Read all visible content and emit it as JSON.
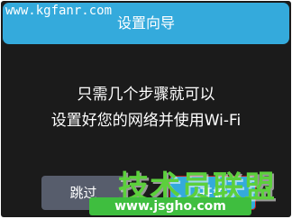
{
  "header": {
    "title": "设置向导"
  },
  "watermark_top": "www.kgfanr.com",
  "message": {
    "line1": "只需几个步骤就可以",
    "line2": "设置好您的网络并使用Wi-Fi"
  },
  "buttons": {
    "skip": "跳过",
    "start": "开始"
  },
  "watermark_bottom": {
    "logo": "技术员联盟",
    "url": "www.jsgho.com"
  },
  "colors": {
    "accent": "#34aadc",
    "background": "#1b1b1b",
    "secondary_button": "#575d6c"
  }
}
